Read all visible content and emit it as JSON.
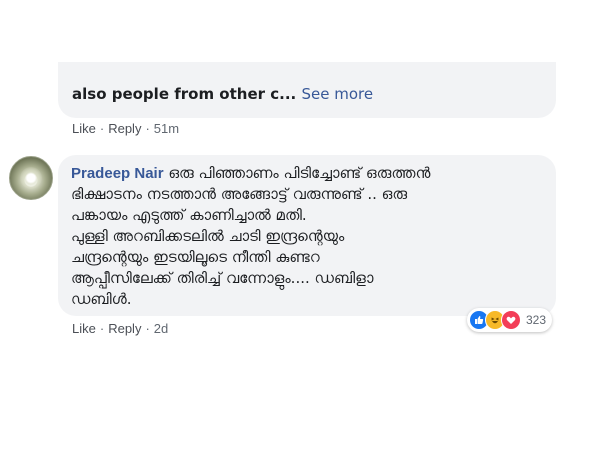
{
  "comment1": {
    "text_truncated": "also people from other c...",
    "see_more": "See more",
    "actions": {
      "like": "Like",
      "reply": "Reply",
      "time": "51m"
    }
  },
  "comment2": {
    "author": "Pradeep Nair",
    "lines": [
      "ഒരു പിഞ്ഞാണം പിടിച്ചോണ്ട് ഒരുത്തൻ",
      "ഭിക്ഷാടനം നടത്താൻ അങ്ങോട്ട് വരുന്നുണ്ട് .. ഒരു",
      "പങ്കായം എടുത്ത് കാണിച്ചാൽ മതി.",
      "പുള്ളി അറബിക്കടലിൽ ചാടി ഇന്ദ്രന്റെയും",
      "ചന്ദ്രന്റെയും ഇടയിലൂടെ നീന്തി കുണ്ടറ",
      "ആപ്പീസിലേക്ക് തിരിച്ച് വന്നോളും.... ഡബിളാ",
      "ഡബിൾ."
    ],
    "actions": {
      "like": "Like",
      "reply": "Reply",
      "time": "2d"
    },
    "reactions": {
      "icons": [
        "like-icon",
        "haha-icon",
        "love-icon"
      ],
      "count": "323"
    }
  },
  "colors": {
    "link": "#385898",
    "bubble": "#f2f3f5",
    "meta": "#606770",
    "like": "#1877f2",
    "haha": "#f7b928",
    "love": "#f33e58"
  }
}
